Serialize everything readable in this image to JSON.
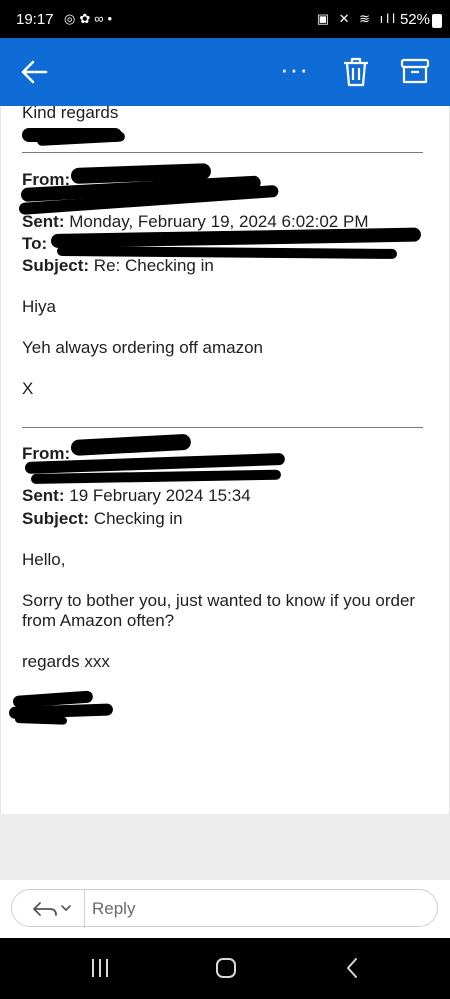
{
  "status": {
    "time": "19:17",
    "battery": "52%"
  },
  "toolbar": {
    "more": "···"
  },
  "email": {
    "kind_regards": "Kind regards",
    "msg1": {
      "from_label": "From:",
      "sent_label": "Sent:",
      "sent_value": "Monday, February 19, 2024 6:02:02 PM",
      "to_label": "To:",
      "subject_label": "Subject:",
      "subject_value": "Re: Checking in",
      "body": [
        "Hiya",
        "Yeh always ordering off amazon",
        "X"
      ]
    },
    "msg2": {
      "from_label": "From:",
      "sent_label": "Sent:",
      "sent_value": "19 February 2024 15:34",
      "subject_label": "Subject:",
      "subject_value": "Checking in",
      "body": [
        "Hello,",
        "Sorry to bother you, just wanted to know if you order",
        "from Amazon often?",
        "regards xxx"
      ]
    }
  },
  "reply": {
    "placeholder": "Reply"
  }
}
